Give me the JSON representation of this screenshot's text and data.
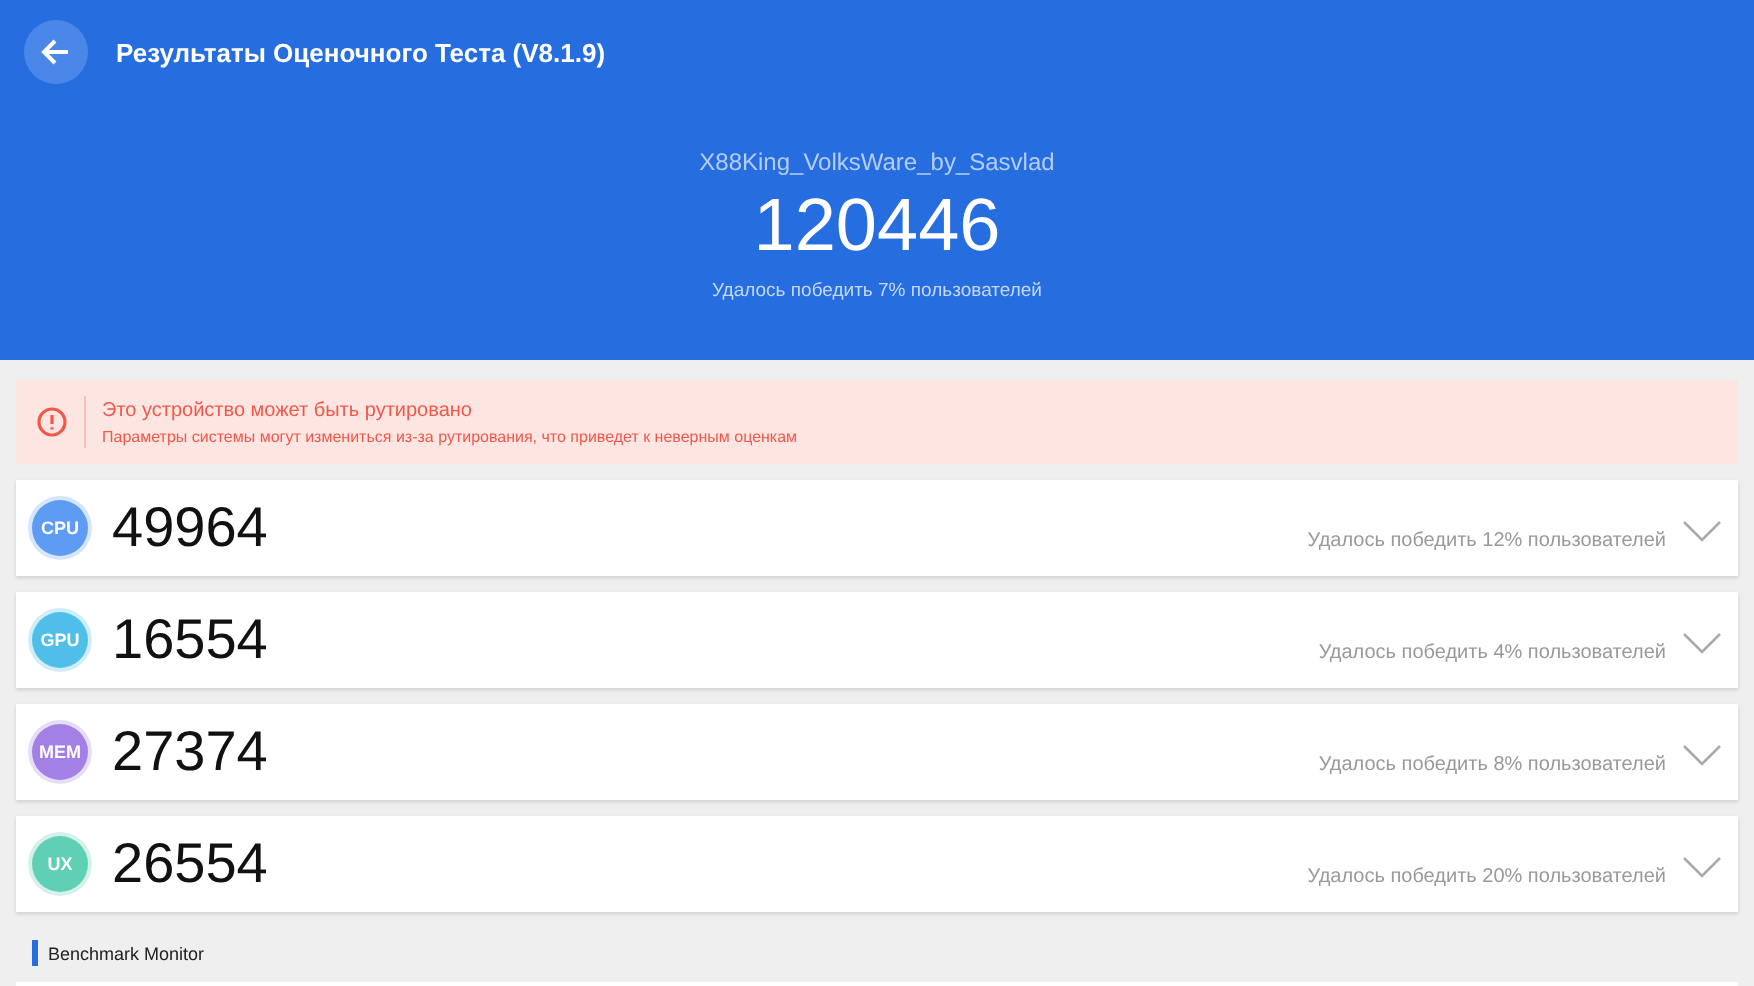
{
  "header": {
    "title": "Результаты Оценочного Теста (V8.1.9)",
    "device": "X88King_VolksWare_by_Sasvlad",
    "score": "120446",
    "rank": "Удалось победить 7% пользователей"
  },
  "warning": {
    "title": "Это устройство может быть рутировано",
    "text": "Параметры системы могут измениться из-за рутирования, что приведет к неверным оценкам"
  },
  "scores": [
    {
      "badge": "CPU",
      "color": "#5d9cf2",
      "score": "49964",
      "rank": "Удалось победить 12% пользователей",
      "expanded": false
    },
    {
      "badge": "GPU",
      "color": "#4fbfea",
      "score": "16554",
      "rank": "Удалось победить 4% пользователей",
      "expanded": false
    },
    {
      "badge": "MEM",
      "color": "#a280e6",
      "score": "27374",
      "rank": "Удалось победить 8% пользователей",
      "expanded": false
    },
    {
      "badge": "UX",
      "color": "#5fd0b5",
      "score": "26554",
      "rank": "Удалось победить 20% пользователей",
      "expanded": false
    }
  ],
  "section": {
    "title": "Benchmark Monitor"
  }
}
